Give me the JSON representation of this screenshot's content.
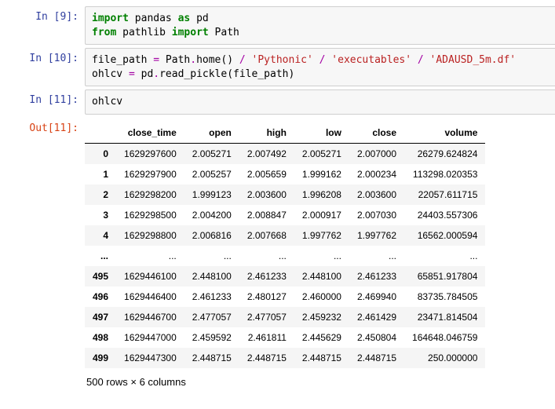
{
  "cells": {
    "c9": {
      "prompt": "In [9]:"
    },
    "c10": {
      "prompt": "In [10]:"
    },
    "c11in": {
      "prompt": "In [11]:"
    },
    "c11out": {
      "prompt": "Out[11]:"
    }
  },
  "code9": {
    "l1": {
      "t1": "import",
      "t2": " pandas ",
      "t3": "as",
      "t4": " pd"
    },
    "l2": {
      "t1": "from",
      "t2": " pathlib ",
      "t3": "import",
      "t4": " Path"
    }
  },
  "code10": {
    "l1": {
      "t1": "file_path ",
      "op1": "=",
      "t2": " Path",
      "op2": ".",
      "t3": "home() ",
      "sl1": "/",
      "sp1": " ",
      "s1": "'Pythonic'",
      "sp2": " ",
      "sl2": "/",
      "sp3": " ",
      "s2": "'executables'",
      "sp4": " ",
      "sl3": "/",
      "sp5": " ",
      "s3": "'ADAUSD_5m.df'"
    },
    "l2": {
      "t1": "ohlcv ",
      "op1": "=",
      "t2": " pd",
      "op2": ".",
      "t3": "read_pickle(file_path)"
    }
  },
  "code11": {
    "l1": "ohlcv"
  },
  "chart_data": {
    "type": "table",
    "columns": [
      "close_time",
      "open",
      "high",
      "low",
      "close",
      "volume"
    ],
    "index": [
      "0",
      "1",
      "2",
      "3",
      "4",
      "...",
      "495",
      "496",
      "497",
      "498",
      "499"
    ],
    "rows": [
      [
        "1629297600",
        "2.005271",
        "2.007492",
        "2.005271",
        "2.007000",
        "26279.624824"
      ],
      [
        "1629297900",
        "2.005257",
        "2.005659",
        "1.999162",
        "2.000234",
        "113298.020353"
      ],
      [
        "1629298200",
        "1.999123",
        "2.003600",
        "1.996208",
        "2.003600",
        "22057.611715"
      ],
      [
        "1629298500",
        "2.004200",
        "2.008847",
        "2.000917",
        "2.007030",
        "24403.557306"
      ],
      [
        "1629298800",
        "2.006816",
        "2.007668",
        "1.997762",
        "1.997762",
        "16562.000594"
      ],
      [
        "...",
        "...",
        "...",
        "...",
        "...",
        "..."
      ],
      [
        "1629446100",
        "2.448100",
        "2.461233",
        "2.448100",
        "2.461233",
        "65851.917804"
      ],
      [
        "1629446400",
        "2.461233",
        "2.480127",
        "2.460000",
        "2.469940",
        "83735.784505"
      ],
      [
        "1629446700",
        "2.477057",
        "2.477057",
        "2.459232",
        "2.461429",
        "23471.814504"
      ],
      [
        "1629447000",
        "2.459592",
        "2.461811",
        "2.445629",
        "2.450804",
        "164648.046759"
      ],
      [
        "1629447300",
        "2.448715",
        "2.448715",
        "2.448715",
        "2.448715",
        "250.000000"
      ]
    ],
    "shape_note": "500 rows × 6 columns"
  }
}
